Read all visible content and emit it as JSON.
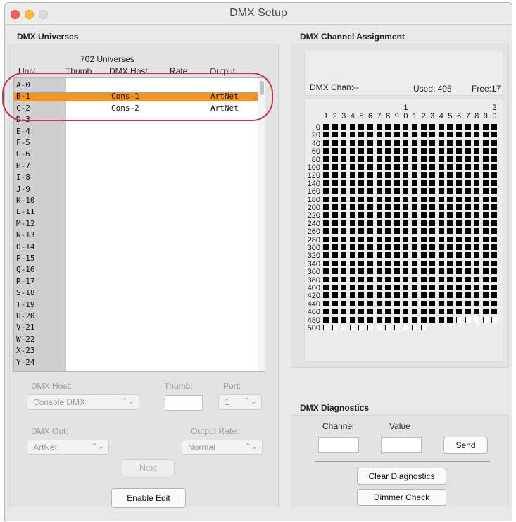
{
  "window": {
    "title": "DMX Setup"
  },
  "universes": {
    "group_title": "DMX Universes",
    "count_label": "702 Universes",
    "columns": [
      "Univ.",
      "Thumb",
      "DMX Host",
      "Rate",
      "Output"
    ],
    "rows": [
      {
        "univ": "A-0",
        "host": "",
        "output": ""
      },
      {
        "univ": "B-1",
        "host": "Cons-1",
        "output": "ArtNet",
        "selected": true
      },
      {
        "univ": "C-2",
        "host": "Cons-2",
        "output": "ArtNet"
      },
      {
        "univ": "D-3",
        "host": "",
        "output": ""
      },
      {
        "univ": "E-4",
        "host": "",
        "output": ""
      },
      {
        "univ": "F-5",
        "host": "",
        "output": ""
      },
      {
        "univ": "G-6",
        "host": "",
        "output": ""
      },
      {
        "univ": "H-7",
        "host": "",
        "output": ""
      },
      {
        "univ": "I-8",
        "host": "",
        "output": ""
      },
      {
        "univ": "J-9",
        "host": "",
        "output": ""
      },
      {
        "univ": "K-10",
        "host": "",
        "output": ""
      },
      {
        "univ": "L-11",
        "host": "",
        "output": ""
      },
      {
        "univ": "M-12",
        "host": "",
        "output": ""
      },
      {
        "univ": "N-13",
        "host": "",
        "output": ""
      },
      {
        "univ": "O-14",
        "host": "",
        "output": ""
      },
      {
        "univ": "P-15",
        "host": "",
        "output": ""
      },
      {
        "univ": "Q-16",
        "host": "",
        "output": ""
      },
      {
        "univ": "R-17",
        "host": "",
        "output": ""
      },
      {
        "univ": "S-18",
        "host": "",
        "output": ""
      },
      {
        "univ": "T-19",
        "host": "",
        "output": ""
      },
      {
        "univ": "U-20",
        "host": "",
        "output": ""
      },
      {
        "univ": "V-21",
        "host": "",
        "output": ""
      },
      {
        "univ": "W-22",
        "host": "",
        "output": ""
      },
      {
        "univ": "X-23",
        "host": "",
        "output": ""
      },
      {
        "univ": "Y-24",
        "host": "",
        "output": ""
      }
    ]
  },
  "host_form": {
    "host_label": "DMX Host:",
    "host_value": "Console DMX",
    "thumb_label": "Thumb:",
    "thumb_value": "",
    "port_label": "Port:",
    "port_value": "1",
    "out_label": "DMX Out:",
    "out_value": "ArtNet",
    "rate_label": "Output Rate:",
    "rate_value": "Normal",
    "next_label": "Next",
    "enable_edit_label": "Enable Edit"
  },
  "channels": {
    "group_title": "DMX Channel Assignment",
    "dmx_chan_label": "DMX Chan:",
    "dmx_chan_value": "--",
    "used_label": "Used:",
    "used_value": "495",
    "free_label": "Free:",
    "free_value": "17",
    "header_tens": {
      "10": "1",
      "20": "2"
    },
    "header_digits": [
      "1",
      "2",
      "3",
      "4",
      "5",
      "6",
      "7",
      "8",
      "9",
      "0",
      "1",
      "2",
      "3",
      "4",
      "5",
      "6",
      "7",
      "8",
      "9",
      "0"
    ],
    "row_labels": [
      "0",
      "20",
      "40",
      "60",
      "80",
      "100",
      "120",
      "140",
      "160",
      "180",
      "200",
      "220",
      "240",
      "260",
      "280",
      "300",
      "320",
      "340",
      "360",
      "380",
      "400",
      "420",
      "440",
      "460",
      "480",
      "500"
    ],
    "total_channels": 512,
    "used_channels": 495
  },
  "diagnostics": {
    "group_title": "DMX Diagnostics",
    "channel_label": "Channel",
    "value_label": "Value",
    "channel_value": "",
    "value_value": "",
    "send_label": "Send",
    "clear_label": "Clear Diagnostics",
    "dimmer_label": "Dimmer Check"
  },
  "colors": {
    "selection": "#f7931e",
    "callout": "#c8334d"
  }
}
